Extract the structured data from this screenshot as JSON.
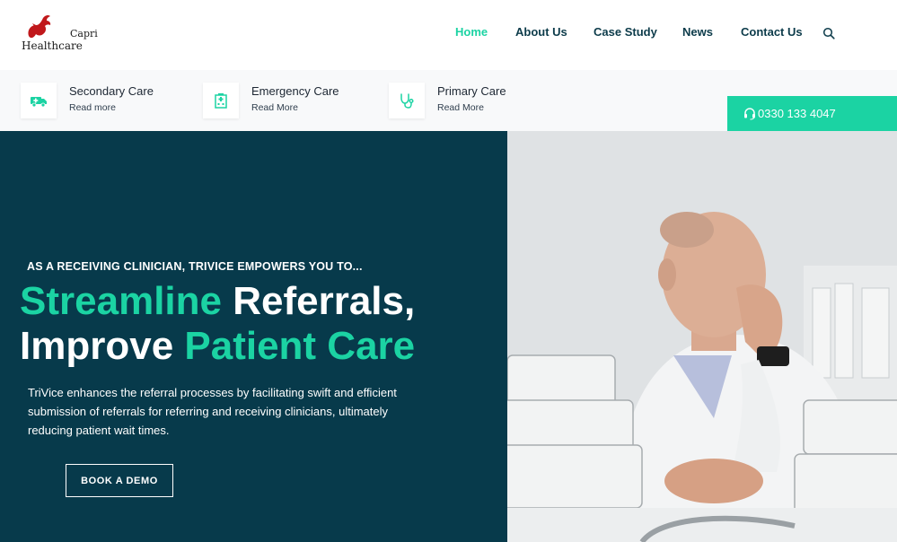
{
  "brand": {
    "line1": "Capri",
    "line2": "Healthcare",
    "logo_color": "#c0181b"
  },
  "nav": {
    "items": [
      {
        "label": "Home",
        "active": true
      },
      {
        "label": "About Us",
        "active": false
      },
      {
        "label": "Case Study",
        "active": false
      },
      {
        "label": "News",
        "active": false
      },
      {
        "label": "Contact Us",
        "active": false
      }
    ],
    "search_icon": "search-icon"
  },
  "services": [
    {
      "title": "Secondary Care",
      "link": "Read more",
      "icon": "ambulance-icon"
    },
    {
      "title": "Emergency Care",
      "link": "Read More",
      "icon": "hospital-icon"
    },
    {
      "title": "Primary Care",
      "link": "Read More",
      "icon": "stethoscope-icon"
    }
  ],
  "phone": {
    "number": "0330 133 4047",
    "icon": "headset-icon"
  },
  "hero": {
    "eyebrow": "AS A RECEIVING CLINICIAN, TRIVICE EMPOWERS YOU TO...",
    "headline_line1_a": "Streamline",
    "headline_line1_b": " Referrals,",
    "headline_line2_a": "Improve ",
    "headline_line2_b": "Patient Care",
    "description": "TriVice enhances the referral processes by facilitating swift and efficient submission of referrals for referring and receiving clinicians, ultimately reducing patient wait times.",
    "cta": "BOOK A DEMO"
  },
  "colors": {
    "accent": "#1bd3a3",
    "dark": "#073a4b",
    "nav_text": "#0c3b4a"
  }
}
